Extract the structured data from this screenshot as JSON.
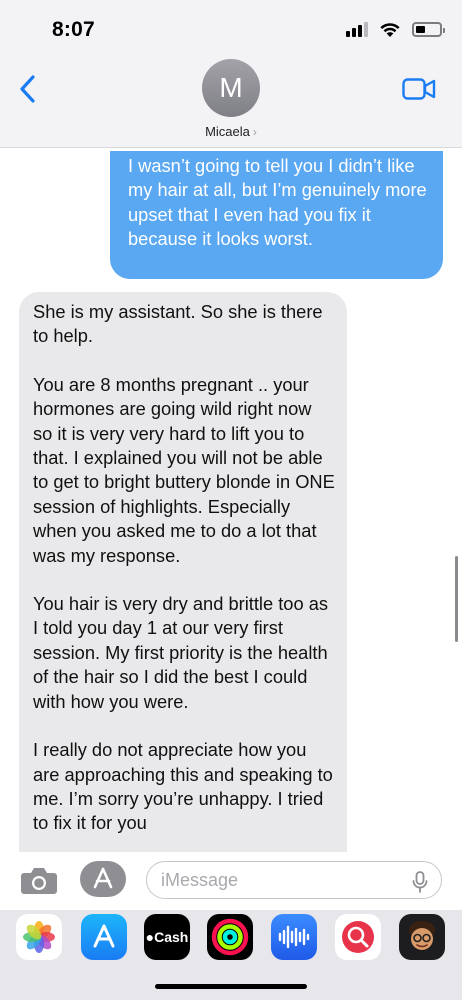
{
  "status_bar": {
    "time": "8:07",
    "icons": [
      "cellular-signal-icon",
      "wifi-icon",
      "battery-icon"
    ],
    "battery_level": 0.4
  },
  "header": {
    "avatar_initial": "M",
    "contact_name": "Micaela",
    "name_chevron": "›",
    "back_icon": "chevron-left-icon",
    "video_icon": "facetime-video-icon"
  },
  "messages": {
    "outgoing": {
      "text": "I wasn’t going to tell you I didn’t like my hair at all, but I’m genuinely more upset that I even had you fix it because it looks worst."
    },
    "incoming": {
      "paragraphs": [
        "She is my assistant. So she is there to help.",
        "You are 8 months pregnant .. your hormones are going wild right now so it is very very hard to lift you to that. I explained you will not be able to get to bright buttery blonde in ONE session of highlights. Especially when you asked me to do a lot that was my response.",
        "You hair is very dry and brittle too as I told you day 1 at our very first session. My first priority is the health of the hair so I did the best I could with how you were.",
        "I really do not appreciate how you are approaching this and speaking to me. I’m sorry you’re unhappy. I tried to fix it for you"
      ]
    }
  },
  "input_bar": {
    "placeholder": "iMessage",
    "value": "",
    "icons": [
      "camera-icon",
      "app-store-apps-icon",
      "microphone-icon"
    ]
  },
  "app_drawer": {
    "apps": [
      {
        "name": "Photos",
        "icon": "photos-icon"
      },
      {
        "name": "App Store",
        "icon": "app-store-icon"
      },
      {
        "name": "Cash",
        "icon": "apple-cash-icon",
        "label": "Cash"
      },
      {
        "name": "Fitness",
        "icon": "activity-rings-icon"
      },
      {
        "name": "Audio",
        "icon": "audio-message-icon"
      },
      {
        "name": "Search",
        "icon": "web-images-search-icon"
      },
      {
        "name": "Memoji",
        "icon": "memoji-icon"
      }
    ]
  },
  "colors": {
    "outgoing_bubble": "#5aa7f2",
    "incoming_bubble": "#e9e9eb",
    "accent": "#1a7cf3"
  }
}
